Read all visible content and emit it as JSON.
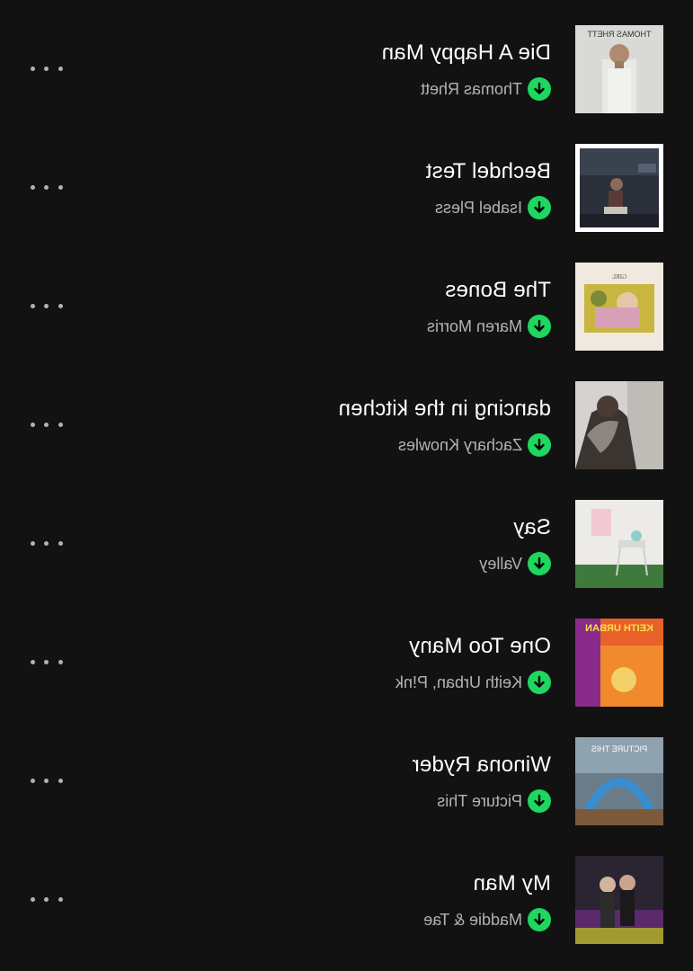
{
  "colors": {
    "background": "#121212",
    "title_text": "#ffffff",
    "artist_text": "#b3b3b3",
    "download_badge": "#1ed760"
  },
  "tracks": [
    {
      "title": "Die A Happy Man",
      "artist": "Thomas Rhett",
      "cover_text": "THOMAS RHETT",
      "downloaded": true
    },
    {
      "title": "Bechdel Test",
      "artist": "Isabel Pless",
      "cover_text": "",
      "downloaded": true
    },
    {
      "title": "The Bones",
      "artist": "Maren Morris",
      "cover_text": "GIRL",
      "downloaded": true
    },
    {
      "title": "dancing in the kitchen",
      "artist": "Zachary Knowles",
      "cover_text": "",
      "downloaded": true
    },
    {
      "title": "Say",
      "artist": "Valley",
      "cover_text": "",
      "downloaded": true
    },
    {
      "title": "One Too Many",
      "artist": "Keith Urban, P!nk",
      "cover_text": "KEITH URBAN",
      "downloaded": true
    },
    {
      "title": "Winona Ryder",
      "artist": "Picture This",
      "cover_text": "PICTURE THIS",
      "downloaded": true
    },
    {
      "title": "My Man",
      "artist": "Maddie & Tae",
      "cover_text": "",
      "downloaded": true
    }
  ]
}
